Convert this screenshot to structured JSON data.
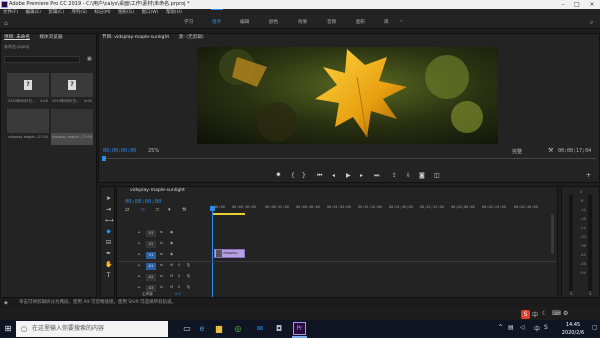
{
  "title": "Adobe Premiere Pro CC 2019 - C:\\用户\\calys\\桌面\\工作\\素材\\未命名.prproj *",
  "menu": [
    "文件(F)",
    "编辑(E)",
    "剪辑(C)",
    "序列(S)",
    "标记(M)",
    "图形(G)",
    "窗口(W)",
    "帮助(H)"
  ],
  "workspaces": {
    "learn": "学习",
    "assembly": "组件",
    "edit": "编辑",
    "color": "颜色",
    "effects": "效果",
    "audio": "音频",
    "graphics": "图形",
    "libraries": "库"
  },
  "project": {
    "tab1": "项目: 未命名",
    "tab2": "媒体浏览器",
    "file": "未命名.prproj",
    "items": [
      {
        "name": "2019年8月5日…",
        "dur": "4:00"
      },
      {
        "name": "2019年8月5日…",
        "dur": "4:00"
      },
      {
        "name": "vidsplay-maple…",
        "dur": "17:04"
      },
      {
        "name": "vidsplay-maple…",
        "dur": "17:04"
      }
    ]
  },
  "program": {
    "source_tab": "节目: vidsplay-maple-sunlight",
    "effects_tab": "源: (无剪辑)",
    "timecode": "00;00;00;00",
    "zoom": "25%",
    "quality": "完整",
    "duration": "00;00;17;04"
  },
  "timeline": {
    "tab": "vidsplay-maple-sunlight",
    "timecode": "00;00;00;00",
    "ruler": [
      "00;00",
      "00;00;16;00",
      "00;00;32;00",
      "00;00;48;00",
      "00;01;04;00",
      "00;01;20;00",
      "00;01;36;00",
      "00;01;52;00",
      "00;02;08;00",
      "00;02;24;00",
      "00;02;40;00"
    ],
    "tracks": [
      "V3",
      "V2",
      "V1",
      "A1",
      "A2",
      "A3"
    ],
    "master": "主声道",
    "master_val": "0.0",
    "clip": "vidsplay-ma"
  },
  "status": "单击可将剪辑拆分为两段。使用 Alt 可忽略链接。使用 Shift 可选择所有轨道。",
  "taskbar": {
    "search": "在这里输入你要搜索的内容",
    "time": "14:45",
    "date": "2020/2/6",
    "lang": "中"
  },
  "meter_ticks": [
    "0",
    "-6",
    "-12",
    "-18",
    "-24",
    "-30",
    "-36",
    "-42",
    "-48",
    "-54"
  ]
}
